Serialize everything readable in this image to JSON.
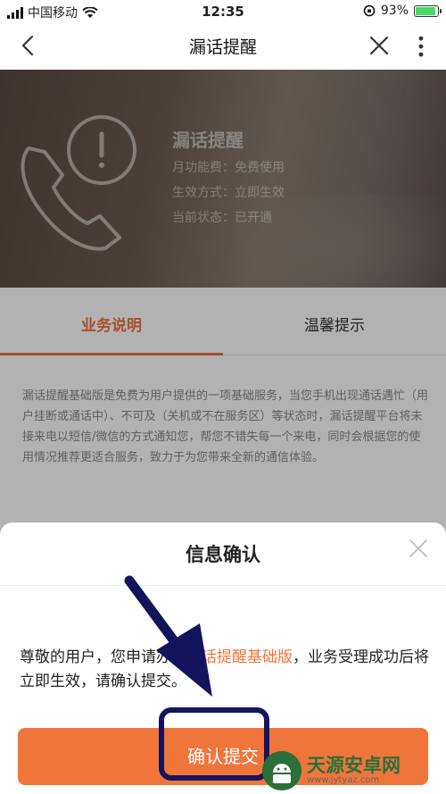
{
  "status_bar": {
    "carrier": "中国移动",
    "time": "12:35",
    "battery_percent": "93%",
    "battery_level": 0.93
  },
  "nav": {
    "title": "漏话提醒"
  },
  "hero": {
    "title": "漏话提醒",
    "rows": [
      "月功能费：免费使用",
      "生效方式：立即生效",
      "当前状态：已开通"
    ]
  },
  "tabs": [
    {
      "label": "业务说明",
      "active": true
    },
    {
      "label": "温馨提示",
      "active": false
    }
  ],
  "description": "漏话提醒基础版是免费为用户提供的一项基础服务，当您手机出现通话遇忙（用户挂断或通话中）、不可及（关机或不在服务区）等状态时，漏话提醒平台将未接来电以短信/微信的方式通知您，帮您不错失每一个来电，同时会根据您的使用情况推荐更适合服务，致力于为您带来全新的通信体验。",
  "dialog": {
    "title": "信息确认",
    "message_prefix": "尊敬的用户，您申请办理",
    "message_highlight": "漏话提醒基础版",
    "message_suffix": "，业务受理成功后将立即生效，请确认提交。",
    "confirm_label": "确认提交"
  },
  "watermark": {
    "text": "天源安卓网",
    "url": "www.jytyaz.com"
  },
  "colors": {
    "accent": "#f0753a",
    "annotation": "#14145c"
  }
}
